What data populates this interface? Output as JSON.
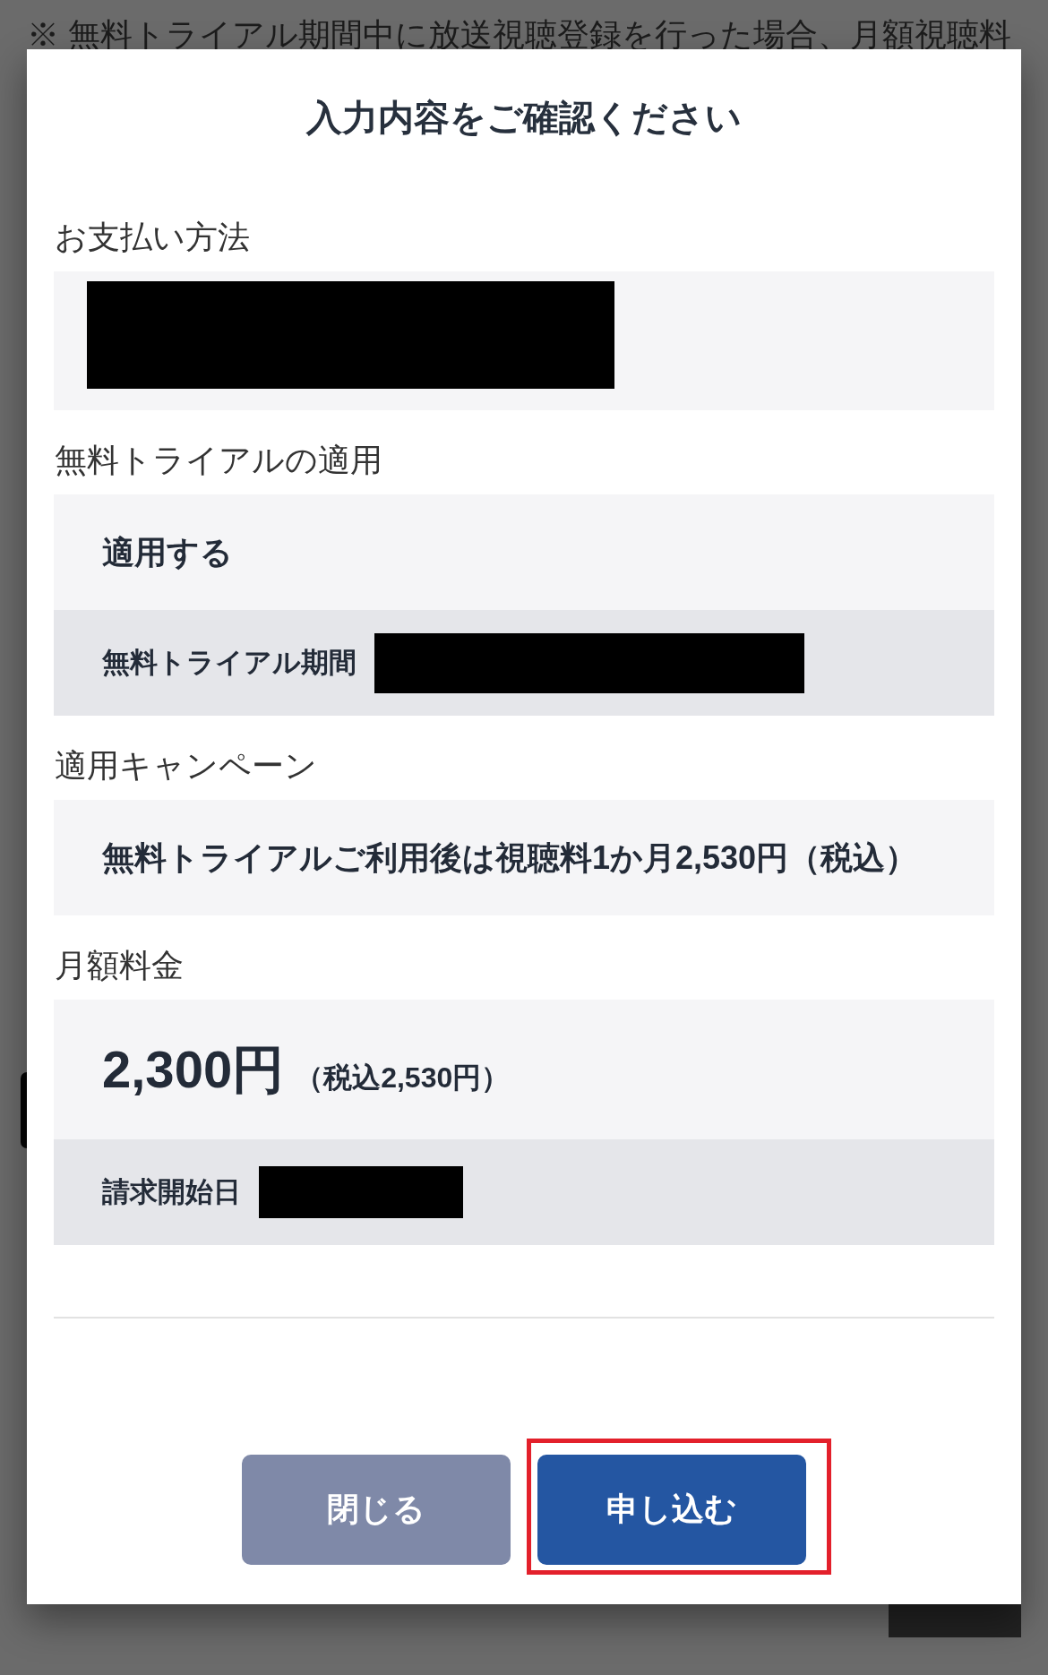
{
  "background": {
    "notice": "※ 無料トライアル期間中に放送視聴登録を行った場合、月額視聴料"
  },
  "dialog": {
    "title": "入力内容をご確認ください",
    "sections": [
      {
        "label": "お支払い方法",
        "rows": [
          {
            "kind": "redacted"
          }
        ]
      },
      {
        "label": "無料トライアルの適用",
        "rows": [
          {
            "kind": "value",
            "text": "適用する"
          },
          {
            "kind": "detail",
            "label": "無料トライアル期間",
            "redacted": true
          }
        ]
      },
      {
        "label": "適用キャンペーン",
        "rows": [
          {
            "kind": "value",
            "text": "無料トライアルご利用後は視聴料1か月2,530円（税込）"
          }
        ]
      },
      {
        "label": "月額料金",
        "rows": [
          {
            "kind": "price",
            "amount": "2,300円",
            "note": "（税込2,530円）"
          },
          {
            "kind": "detail",
            "label": "請求開始日",
            "redacted": true
          }
        ]
      }
    ],
    "buttons": [
      {
        "label": "閉じる",
        "kind": "secondary",
        "highlighted": false
      },
      {
        "label": "申し込む",
        "kind": "primary",
        "highlighted": true
      }
    ]
  }
}
